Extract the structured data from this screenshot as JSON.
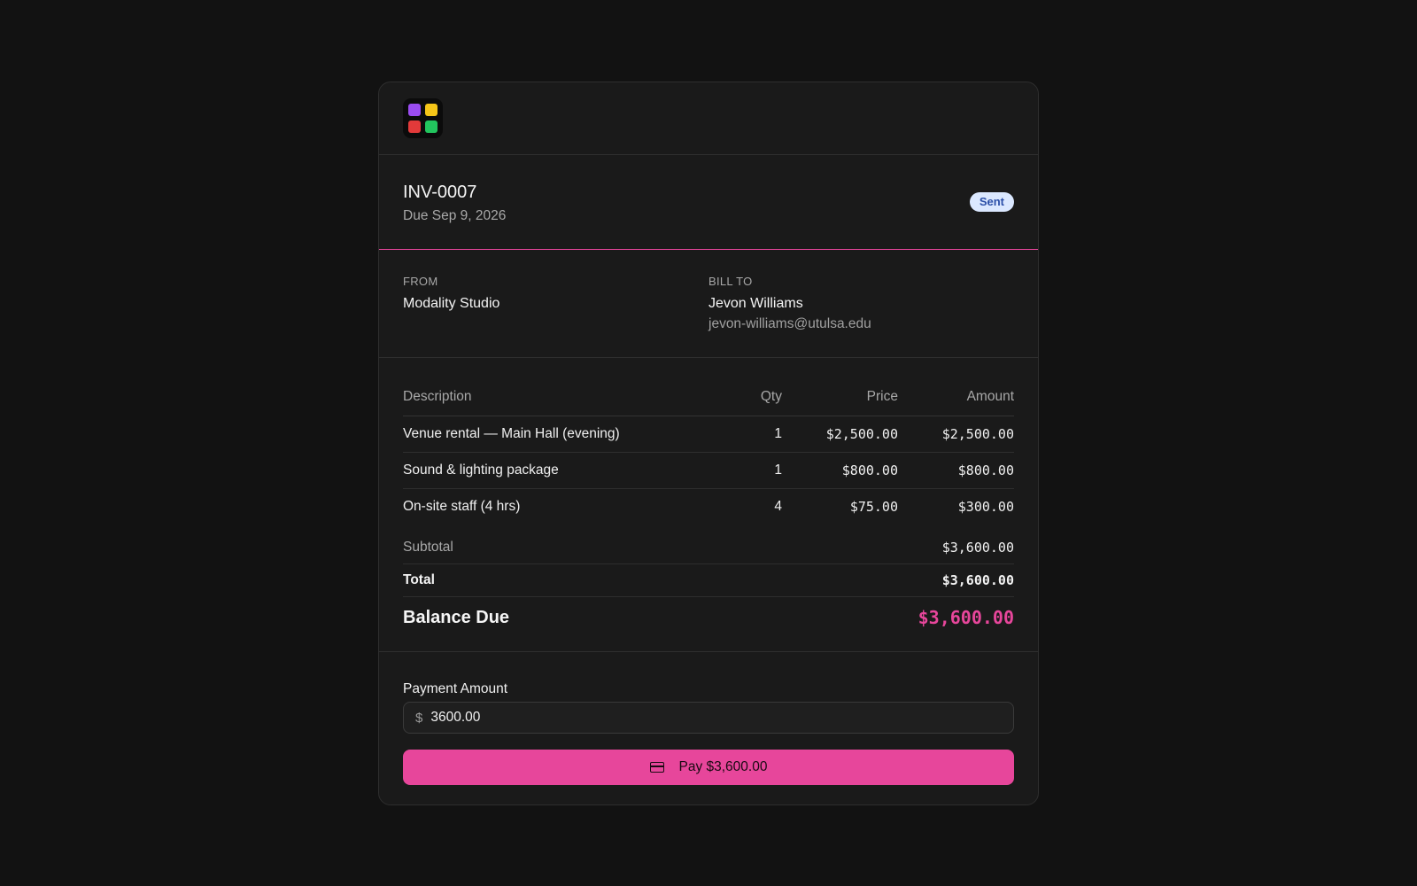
{
  "invoice": {
    "number": "INV-0007",
    "due": "Due Sep 9, 2026",
    "status": "Sent"
  },
  "from": {
    "label": "FROM",
    "name": "Modality Studio"
  },
  "bill_to": {
    "label": "BILL TO",
    "name": "Jevon Williams",
    "email": "jevon-williams@utulsa.edu"
  },
  "table": {
    "headers": {
      "description": "Description",
      "qty": "Qty",
      "price": "Price",
      "amount": "Amount"
    },
    "rows": [
      {
        "description": "Venue rental — Main Hall (evening)",
        "qty": "1",
        "price": "$2,500.00",
        "amount": "$2,500.00"
      },
      {
        "description": "Sound & lighting package",
        "qty": "1",
        "price": "$800.00",
        "amount": "$800.00"
      },
      {
        "description": "On-site staff (4 hrs)",
        "qty": "4",
        "price": "$75.00",
        "amount": "$300.00"
      }
    ]
  },
  "totals": {
    "subtotal_label": "Subtotal",
    "subtotal": "$3,600.00",
    "total_label": "Total",
    "total": "$3,600.00",
    "balance_label": "Balance Due",
    "balance": "$3,600.00"
  },
  "payment": {
    "label": "Payment Amount",
    "currency_symbol": "$",
    "value": "3600.00",
    "button_label": "Pay $3,600.00"
  },
  "colors": {
    "accent": "#e7469b",
    "badge_bg": "#dbe8ff",
    "badge_text": "#2b4fa8",
    "background": "#121212",
    "card": "#1a1a1a"
  },
  "icons": {
    "logo": "app-grid-logo",
    "pay_button": "credit-card-icon"
  }
}
